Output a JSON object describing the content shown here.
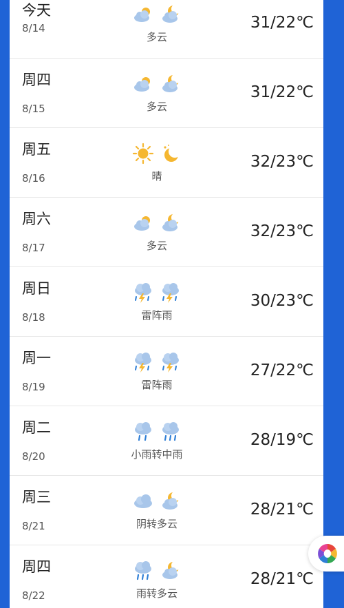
{
  "forecast": [
    {
      "day": "今天",
      "date": "8/14",
      "desc": "多云",
      "temp": "31/22℃",
      "icon_day": "cloudy-icon",
      "icon_night": "partly-cloudy-night-icon"
    },
    {
      "day": "周四",
      "date": "8/15",
      "desc": "多云",
      "temp": "31/22℃",
      "icon_day": "cloudy-icon",
      "icon_night": "partly-cloudy-night-icon"
    },
    {
      "day": "周五",
      "date": "8/16",
      "desc": "晴",
      "temp": "32/23℃",
      "icon_day": "sun-icon",
      "icon_night": "moon-icon"
    },
    {
      "day": "周六",
      "date": "8/17",
      "desc": "多云",
      "temp": "32/23℃",
      "icon_day": "cloudy-icon",
      "icon_night": "partly-cloudy-night-icon"
    },
    {
      "day": "周日",
      "date": "8/18",
      "desc": "雷阵雨",
      "temp": "30/23℃",
      "icon_day": "thunderstorm-icon",
      "icon_night": "thunderstorm-icon"
    },
    {
      "day": "周一",
      "date": "8/19",
      "desc": "雷阵雨",
      "temp": "27/22℃",
      "icon_day": "thunderstorm-icon",
      "icon_night": "thunderstorm-icon"
    },
    {
      "day": "周二",
      "date": "8/20",
      "desc": "小雨转中雨",
      "temp": "28/19℃",
      "icon_day": "rain-icon",
      "icon_night": "rain-icon"
    },
    {
      "day": "周三",
      "date": "8/21",
      "desc": "阴转多云",
      "temp": "28/21℃",
      "icon_day": "overcast-icon",
      "icon_night": "partly-cloudy-night-icon"
    },
    {
      "day": "周四",
      "date": "8/22",
      "desc": "雨转多云",
      "temp": "28/21℃",
      "icon_day": "rain-icon",
      "icon_night": "partly-cloudy-night-icon"
    }
  ],
  "floating_button": {
    "icon": "assistant-app-icon"
  },
  "colors": {
    "background": "#1f63d6",
    "card": "#ffffff",
    "sun": "#f5b731",
    "cloud": "#a8c6ea",
    "rain": "#2f7fd6"
  }
}
